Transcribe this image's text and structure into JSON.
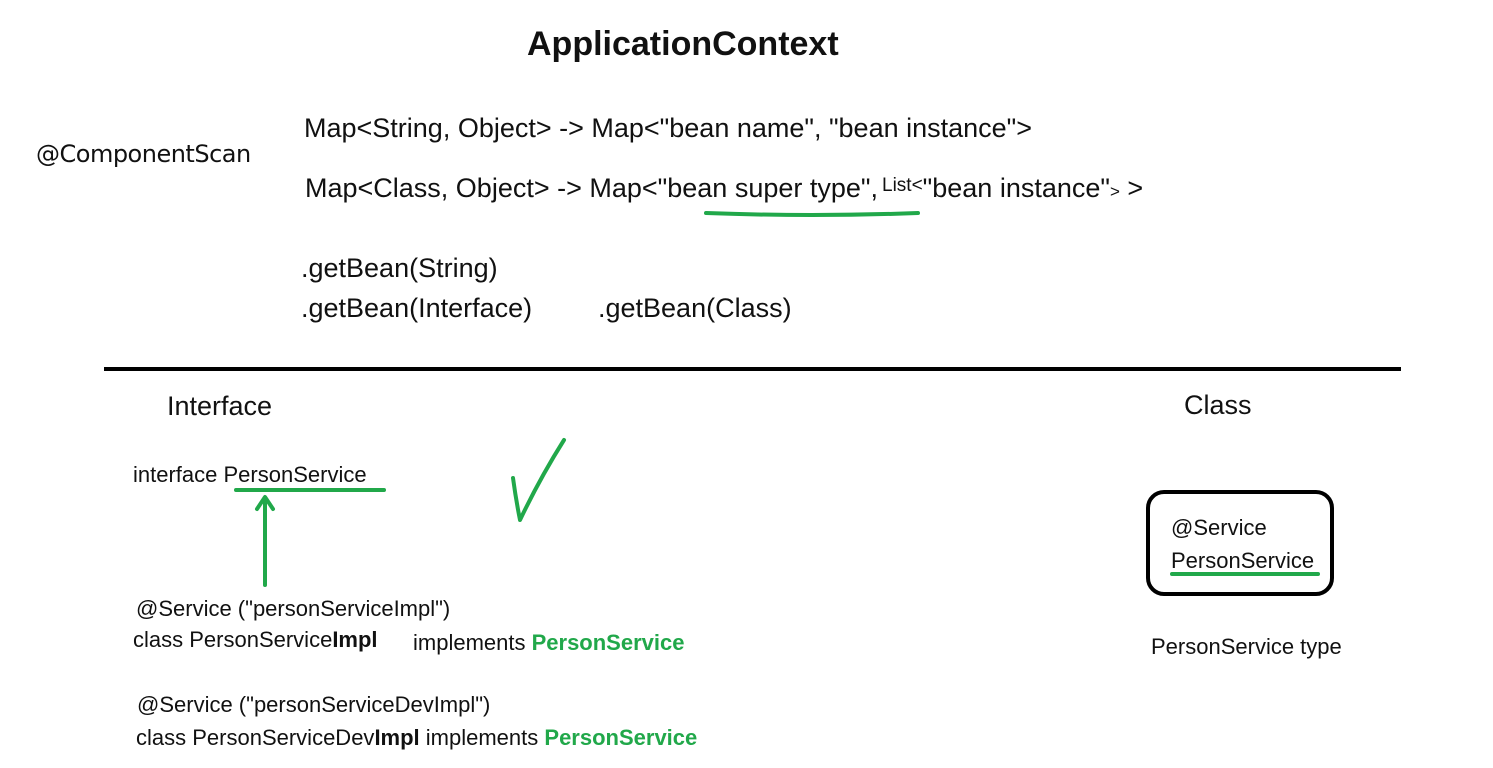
{
  "title": "ApplicationContext",
  "component_scan": "@ComponentScan",
  "map_lines": {
    "line1": "Map<String, Object> -> Map<\"bean name\", \"bean instance\">",
    "line2_prefix": "Map<Class, Object>  -> Map<",
    "line2_underlined": "\"bean super type\"",
    "line2_comma": ",",
    "line2_list": "List<",
    "line2_rest": "\"bean instance\"",
    "line2_end_small": ">",
    "line2_end": " >"
  },
  "get_bean": {
    "string": ".getBean(String)",
    "interface": ".getBean(Interface)",
    "class": ".getBean(Class)"
  },
  "sections": {
    "interface_heading": "Interface",
    "class_heading": "Class"
  },
  "interface_block": {
    "decl_prefix": "interface ",
    "decl_name": "PersonService",
    "impl1_annotation": "@Service (\"personServiceImpl\")",
    "impl1_class_prefix": "class PersonService",
    "impl1_class_bold": "Impl",
    "impl1_implements": "implements ",
    "impl1_interface": "PersonService",
    "impl2_annotation": "@Service (\"personServiceDevImpl\")",
    "impl2_class_prefix": "class PersonServiceDev",
    "impl2_class_bold": "Impl",
    "impl2_implements": " implements ",
    "impl2_interface": "PersonService"
  },
  "class_block": {
    "annotation": "@Service",
    "name": "PersonService",
    "caption": "PersonService type"
  },
  "colors": {
    "accent_green": "#21a84a",
    "ink": "#111111",
    "background": "#ffffff"
  },
  "icons": {
    "arrow": "up-arrow-icon",
    "check": "checkmark-icon"
  }
}
